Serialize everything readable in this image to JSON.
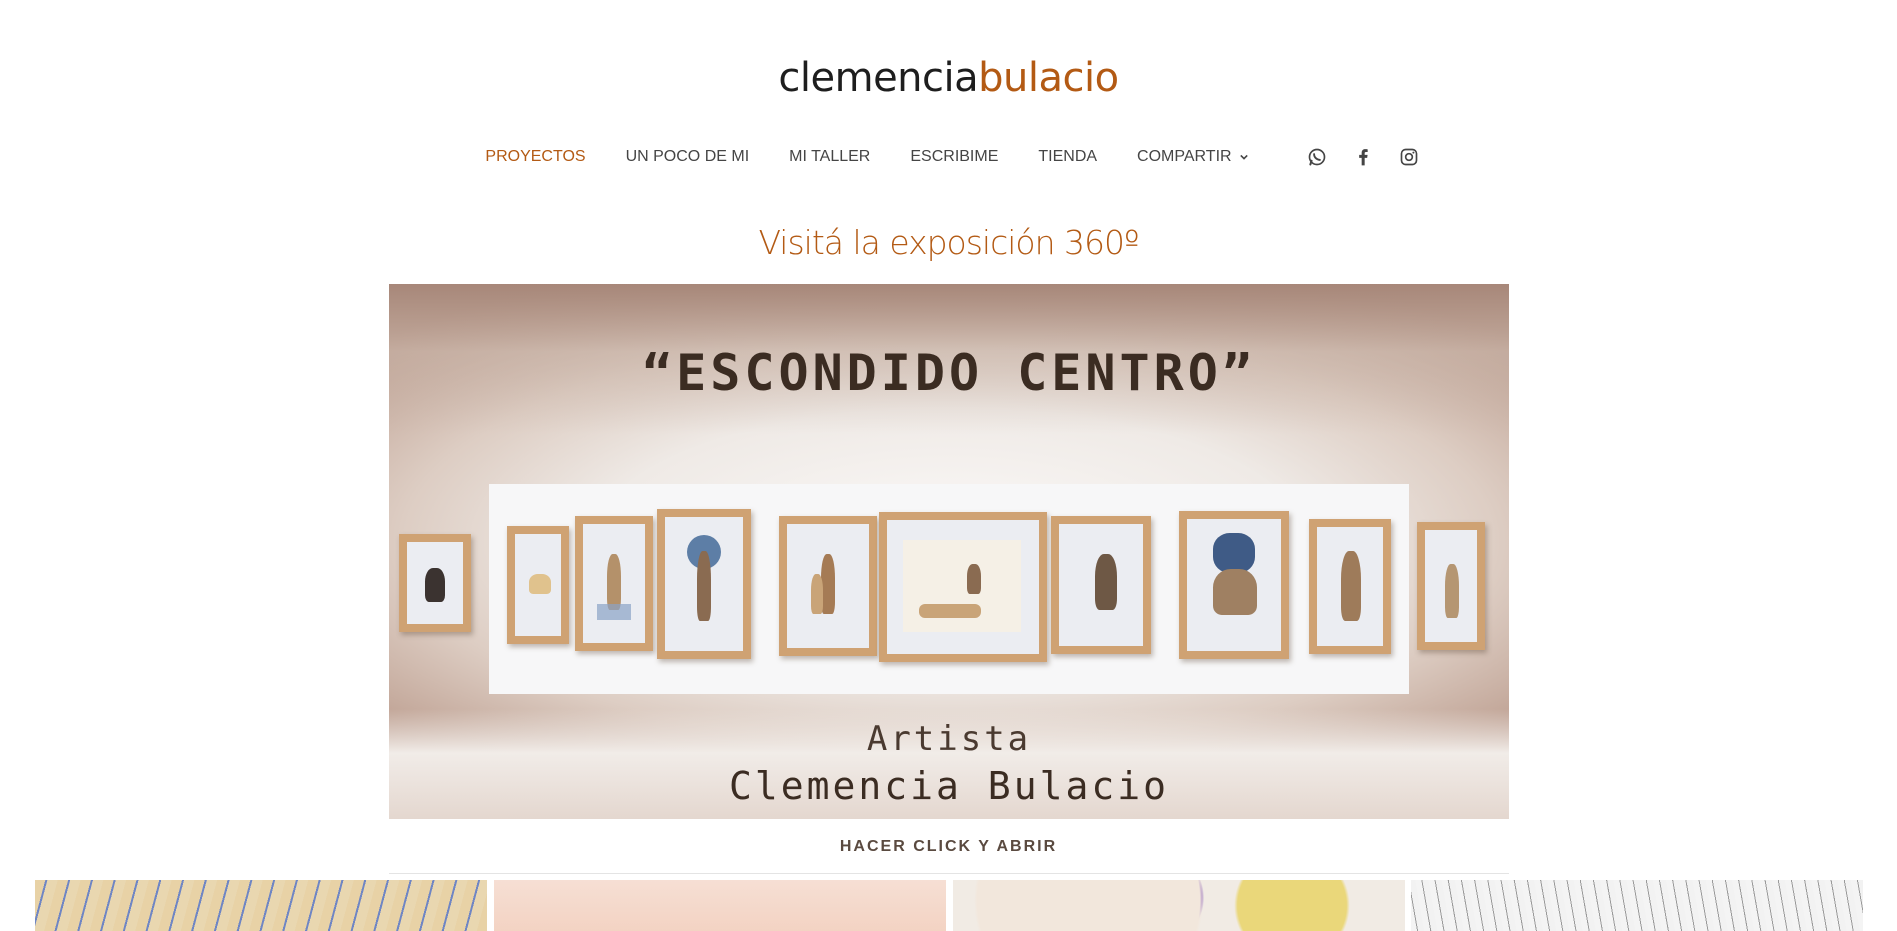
{
  "logo": {
    "first": "clemencia",
    "last": "bulacio"
  },
  "nav": {
    "items": [
      {
        "label": "PROYECTOS",
        "active": true
      },
      {
        "label": "UN POCO DE MI",
        "active": false
      },
      {
        "label": "MI TALLER",
        "active": false
      },
      {
        "label": "ESCRIBIME",
        "active": false
      },
      {
        "label": "TIENDA",
        "active": false
      },
      {
        "label": "COMPARTIR",
        "active": false,
        "has_dropdown": true
      }
    ],
    "socials": [
      "whatsapp-icon",
      "facebook-icon",
      "instagram-icon"
    ]
  },
  "main": {
    "heading": "Visitá la exposición 360º",
    "hero": {
      "title": "“ESCONDIDO CENTRO”",
      "artist_label": "Artista",
      "artist_name": "Clemencia Bulacio"
    },
    "cta": "HACER CLICK Y ABRIR"
  },
  "colors": {
    "accent": "#b35a14",
    "text": "#454545"
  }
}
